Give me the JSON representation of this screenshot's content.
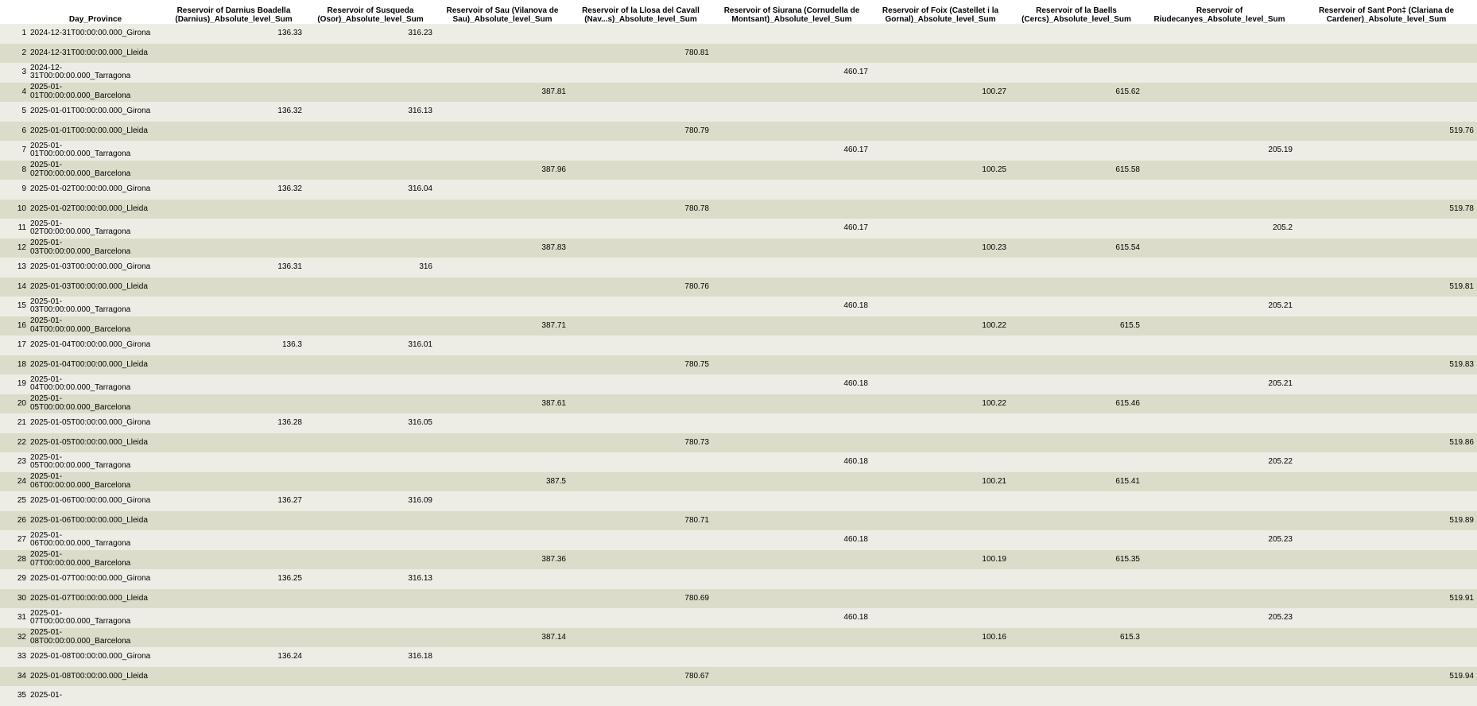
{
  "columns": [
    "",
    "Day_Province",
    "Reservoir of Darnius Boadella (Darnius)_Absolute_level_Sum",
    "Reservoir of Susqueda (Osor)_Absolute_level_Sum",
    "Reservoir of Sau (Vilanova de Sau)_Absolute_level_Sum",
    "Reservoir of la Llosa del Cavall (Nav...s)_Absolute_level_Sum",
    "Reservoir of Siurana (Cornudella de Montsant)_Absolute_level_Sum",
    "Reservoir of Foix (Castellet i la Gornal)_Absolute_level_Sum",
    "Reservoir of la Baells (Cercs)_Absolute_level_Sum",
    "Reservoir of Riudecanyes_Absolute_level_Sum",
    "Reservoir of Sant Pon‡ (Clariana de Cardener)_Absolute_level_Sum"
  ],
  "rows": [
    [
      "1",
      "2024-12-31T00:00:00.000_Girona",
      "136.33",
      "316.23",
      "",
      "",
      "",
      "",
      "",
      "",
      ""
    ],
    [
      "2",
      "2024-12-31T00:00:00.000_Lleida",
      "",
      "",
      "",
      "780.81",
      "",
      "",
      "",
      "",
      ""
    ],
    [
      "3",
      "2024-12-31T00:00:00.000_Tarragona",
      "",
      "",
      "",
      "",
      "460.17",
      "",
      "",
      "",
      ""
    ],
    [
      "4",
      "2025-01-01T00:00:00.000_Barcelona",
      "",
      "",
      "387.81",
      "",
      "",
      "100.27",
      "615.62",
      "",
      ""
    ],
    [
      "5",
      "2025-01-01T00:00:00.000_Girona",
      "136.32",
      "316.13",
      "",
      "",
      "",
      "",
      "",
      "",
      ""
    ],
    [
      "6",
      "2025-01-01T00:00:00.000_Lleida",
      "",
      "",
      "",
      "780.79",
      "",
      "",
      "",
      "",
      "519.76"
    ],
    [
      "7",
      "2025-01-01T00:00:00.000_Tarragona",
      "",
      "",
      "",
      "",
      "460.17",
      "",
      "",
      "205.19",
      ""
    ],
    [
      "8",
      "2025-01-02T00:00:00.000_Barcelona",
      "",
      "",
      "387.96",
      "",
      "",
      "100.25",
      "615.58",
      "",
      ""
    ],
    [
      "9",
      "2025-01-02T00:00:00.000_Girona",
      "136.32",
      "316.04",
      "",
      "",
      "",
      "",
      "",
      "",
      ""
    ],
    [
      "10",
      "2025-01-02T00:00:00.000_Lleida",
      "",
      "",
      "",
      "780.78",
      "",
      "",
      "",
      "",
      "519.78"
    ],
    [
      "11",
      "2025-01-02T00:00:00.000_Tarragona",
      "",
      "",
      "",
      "",
      "460.17",
      "",
      "",
      "205.2",
      ""
    ],
    [
      "12",
      "2025-01-03T00:00:00.000_Barcelona",
      "",
      "",
      "387.83",
      "",
      "",
      "100.23",
      "615.54",
      "",
      ""
    ],
    [
      "13",
      "2025-01-03T00:00:00.000_Girona",
      "136.31",
      "316",
      "",
      "",
      "",
      "",
      "",
      "",
      ""
    ],
    [
      "14",
      "2025-01-03T00:00:00.000_Lleida",
      "",
      "",
      "",
      "780.76",
      "",
      "",
      "",
      "",
      "519.81"
    ],
    [
      "15",
      "2025-01-03T00:00:00.000_Tarragona",
      "",
      "",
      "",
      "",
      "460.18",
      "",
      "",
      "205.21",
      ""
    ],
    [
      "16",
      "2025-01-04T00:00:00.000_Barcelona",
      "",
      "",
      "387.71",
      "",
      "",
      "100.22",
      "615.5",
      "",
      ""
    ],
    [
      "17",
      "2025-01-04T00:00:00.000_Girona",
      "136.3",
      "316.01",
      "",
      "",
      "",
      "",
      "",
      "",
      ""
    ],
    [
      "18",
      "2025-01-04T00:00:00.000_Lleida",
      "",
      "",
      "",
      "780.75",
      "",
      "",
      "",
      "",
      "519.83"
    ],
    [
      "19",
      "2025-01-04T00:00:00.000_Tarragona",
      "",
      "",
      "",
      "",
      "460.18",
      "",
      "",
      "205.21",
      ""
    ],
    [
      "20",
      "2025-01-05T00:00:00.000_Barcelona",
      "",
      "",
      "387.61",
      "",
      "",
      "100.22",
      "615.46",
      "",
      ""
    ],
    [
      "21",
      "2025-01-05T00:00:00.000_Girona",
      "136.28",
      "316.05",
      "",
      "",
      "",
      "",
      "",
      "",
      ""
    ],
    [
      "22",
      "2025-01-05T00:00:00.000_Lleida",
      "",
      "",
      "",
      "780.73",
      "",
      "",
      "",
      "",
      "519.86"
    ],
    [
      "23",
      "2025-01-05T00:00:00.000_Tarragona",
      "",
      "",
      "",
      "",
      "460.18",
      "",
      "",
      "205.22",
      ""
    ],
    [
      "24",
      "2025-01-06T00:00:00.000_Barcelona",
      "",
      "",
      "387.5",
      "",
      "",
      "100.21",
      "615.41",
      "",
      ""
    ],
    [
      "25",
      "2025-01-06T00:00:00.000_Girona",
      "136.27",
      "316.09",
      "",
      "",
      "",
      "",
      "",
      "",
      ""
    ],
    [
      "26",
      "2025-01-06T00:00:00.000_Lleida",
      "",
      "",
      "",
      "780.71",
      "",
      "",
      "",
      "",
      "519.89"
    ],
    [
      "27",
      "2025-01-06T00:00:00.000_Tarragona",
      "",
      "",
      "",
      "",
      "460.18",
      "",
      "",
      "205.23",
      ""
    ],
    [
      "28",
      "2025-01-07T00:00:00.000_Barcelona",
      "",
      "",
      "387.36",
      "",
      "",
      "100.19",
      "615.35",
      "",
      ""
    ],
    [
      "29",
      "2025-01-07T00:00:00.000_Girona",
      "136.25",
      "316.13",
      "",
      "",
      "",
      "",
      "",
      "",
      ""
    ],
    [
      "30",
      "2025-01-07T00:00:00.000_Lleida",
      "",
      "",
      "",
      "780.69",
      "",
      "",
      "",
      "",
      "519.91"
    ],
    [
      "31",
      "2025-01-07T00:00:00.000_Tarragona",
      "",
      "",
      "",
      "",
      "460.18",
      "",
      "",
      "205.23",
      ""
    ],
    [
      "32",
      "2025-01-08T00:00:00.000_Barcelona",
      "",
      "",
      "387.14",
      "",
      "",
      "100.16",
      "615.3",
      "",
      ""
    ],
    [
      "33",
      "2025-01-08T00:00:00.000_Girona",
      "136.24",
      "316.18",
      "",
      "",
      "",
      "",
      "",
      "",
      ""
    ],
    [
      "34",
      "2025-01-08T00:00:00.000_Lleida",
      "",
      "",
      "",
      "780.67",
      "",
      "",
      "",
      "",
      "519.94"
    ],
    [
      "35",
      "2025-01-",
      "",
      "",
      "",
      "",
      "",
      "",
      "",
      "",
      ""
    ]
  ]
}
